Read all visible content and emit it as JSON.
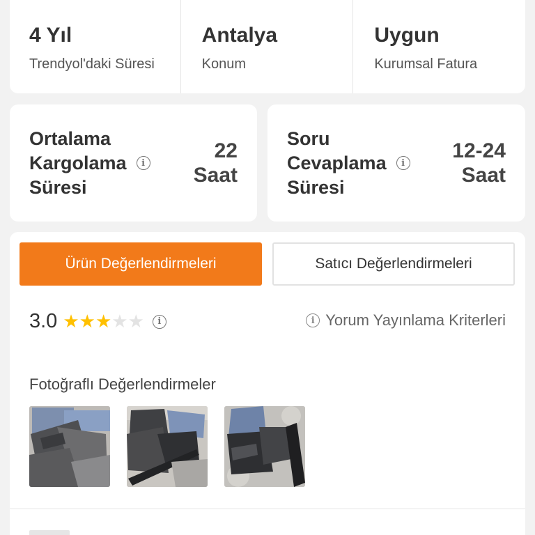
{
  "seller_stats": [
    {
      "value": "4 Yıl",
      "label": "Trendyol'daki Süresi"
    },
    {
      "value": "Antalya",
      "label": "Konum"
    },
    {
      "value": "Uygun",
      "label": "Kurumsal Fatura"
    }
  ],
  "shipping": {
    "title_lines": [
      "Ortalama",
      "Kargolama",
      "Süresi"
    ],
    "value": "22 Saat"
  },
  "answering": {
    "title_lines": [
      "Soru",
      "Cevaplama",
      "Süresi"
    ],
    "value_lines": [
      "12-24",
      "Saat"
    ]
  },
  "tabs": {
    "product_reviews": "Ürün Değerlendirmeleri",
    "seller_reviews": "Satıcı Değerlendirmeleri"
  },
  "rating": {
    "score": "3.0",
    "stars_filled": 3,
    "stars_total": 5
  },
  "criteria_link": "Yorum Yayınlama Kriterleri",
  "photos": {
    "title": "Fotoğraflı Değerlendirmeler",
    "count": 3
  },
  "colors": {
    "accent": "#f27a1a",
    "star": "#ffc000",
    "star_empty": "#e3e3e3"
  }
}
